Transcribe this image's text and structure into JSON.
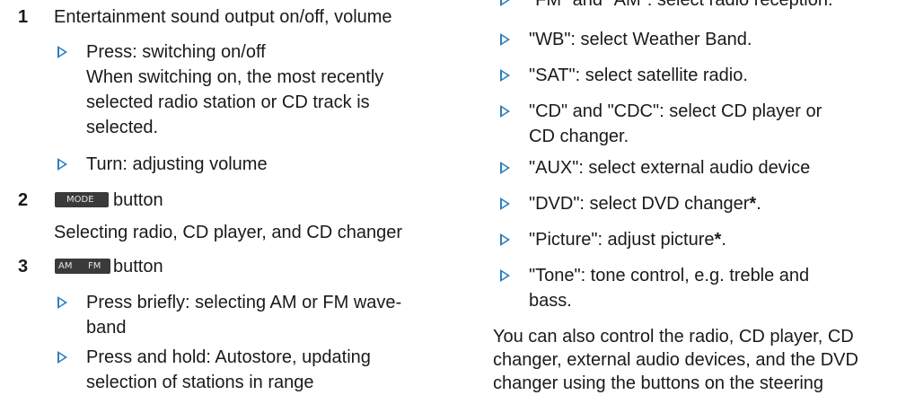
{
  "left": {
    "item1": {
      "number": "1",
      "title": "Entertainment sound output on/off, volume",
      "bullet1": "Press: switching on/off",
      "bullet1_l2": "When switching on, the most recently",
      "bullet1_l3": "selected radio station or CD track is",
      "bullet1_l4": "selected.",
      "bullet2": "Turn: adjusting volume"
    },
    "item2": {
      "number": "2",
      "button_label": "MODE",
      "suffix": "button",
      "desc": "Selecting radio, CD player, and CD changer"
    },
    "item3": {
      "number": "3",
      "button_label_am": "AM",
      "button_label_fm": "FM",
      "suffix": "button",
      "bullet1_l1": "Press briefly: selecting AM or FM wave-",
      "bullet1_l2": "band",
      "bullet2_l1": "Press and hold: Autostore, updating",
      "bullet2_l2": "selection of stations in range"
    }
  },
  "right": {
    "b0": "\"FM\" and \"AM\": select radio reception.",
    "b1": "\"WB\": select Weather Band.",
    "b2": "\"SAT\": select satellite radio.",
    "b3_l1": "\"CD\" and \"CDC\": select CD player or",
    "b3_l2": "CD changer.",
    "b4": "\"AUX\": select external audio device",
    "b5": "\"DVD\": select DVD changer",
    "b5_star": "*",
    "b5_end": ".",
    "b6": "\"Picture\": adjust picture",
    "b6_star": "*",
    "b6_end": ".",
    "b7_l1": "\"Tone\": tone control, e.g. treble and",
    "b7_l2": "bass.",
    "para_l1": "You can also control the radio, CD player, CD",
    "para_l2": "changer, external audio devices, and the DVD",
    "para_l3": "changer using the buttons on the steering"
  },
  "colors": {
    "bullet": "#2d7fc0",
    "text": "#1a1a1a",
    "button_bg": "#3a3a3a"
  },
  "icons": {
    "bullet": "triangle-bullet-icon"
  }
}
